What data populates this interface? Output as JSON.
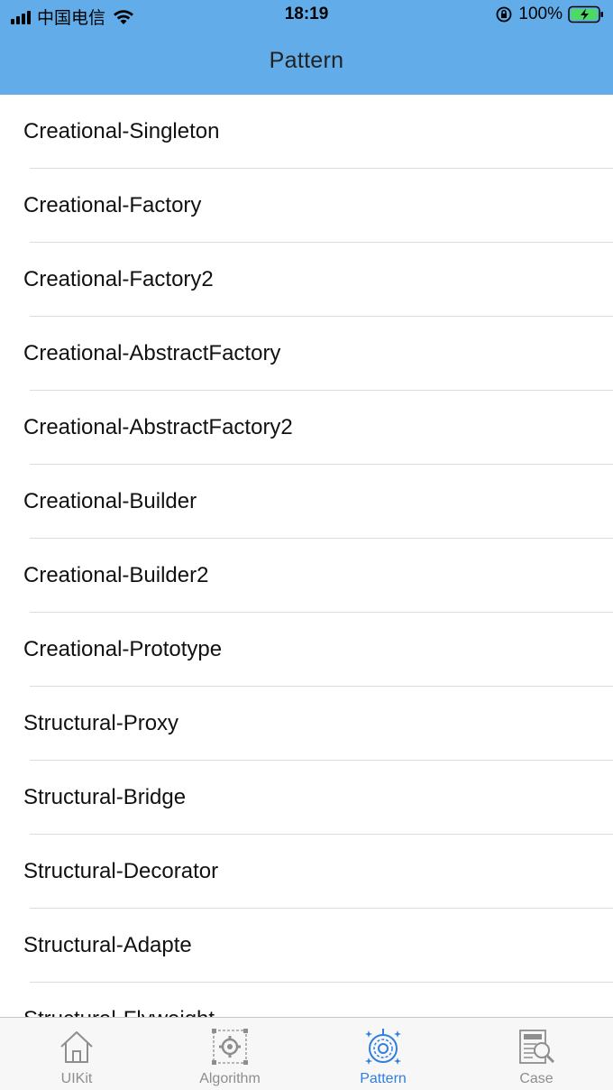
{
  "status_bar": {
    "carrier": "中国电信",
    "time": "18:19",
    "battery": "100%"
  },
  "nav": {
    "title": "Pattern"
  },
  "list": {
    "items": [
      "Creational-Singleton",
      "Creational-Factory",
      "Creational-Factory2",
      "Creational-AbstractFactory",
      "Creational-AbstractFactory2",
      "Creational-Builder",
      "Creational-Builder2",
      "Creational-Prototype",
      "Structural-Proxy",
      "Structural-Bridge",
      "Structural-Decorator",
      "Structural-Adapte",
      "Structural-Flyweight"
    ]
  },
  "tabbar": {
    "active_color": "#2f7fe0",
    "inactive_color": "#8e8e8e",
    "tabs": [
      {
        "label": "UIKit",
        "icon": "house-icon",
        "active": false
      },
      {
        "label": "Algorithm",
        "icon": "network-gear-icon",
        "active": false
      },
      {
        "label": "Pattern",
        "icon": "pattern-dial-icon",
        "active": true
      },
      {
        "label": "Case",
        "icon": "document-search-icon",
        "active": false
      }
    ]
  },
  "colors": {
    "header": "#62ade9",
    "separator": "#dcdcdc"
  }
}
